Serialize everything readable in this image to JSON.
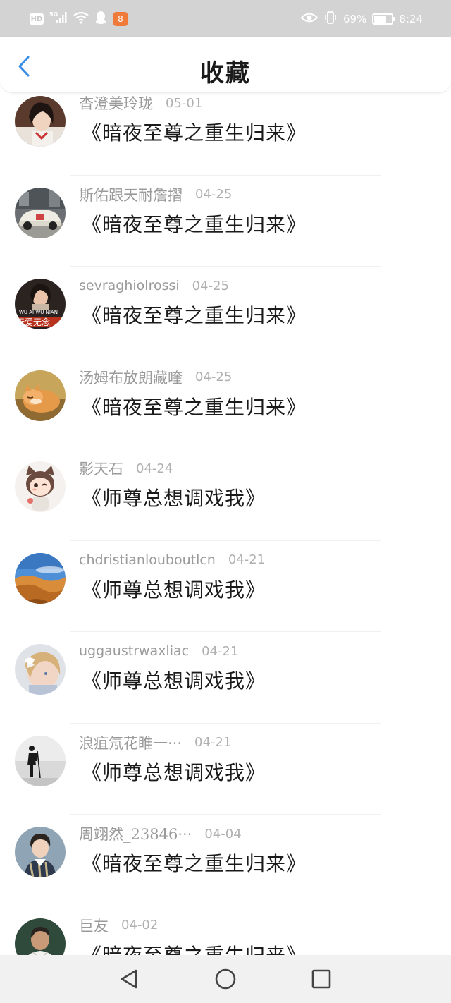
{
  "status_bar": {
    "hd": "HD",
    "network": "5G",
    "app_badge": "8",
    "battery_percent": "69%",
    "battery_level": 0.69,
    "time": "8:24"
  },
  "header": {
    "title": "收藏",
    "back_icon": "chevron-left-icon",
    "accent": "#3a8ee6"
  },
  "favorites": [
    {
      "user": "杳澄美玲珑",
      "date": "05-01",
      "book": "《暗夜至尊之重生归来》",
      "avatar": "woman-portrait"
    },
    {
      "user": "斯佑跟天耐詹摺",
      "date": "04-25",
      "book": "《暗夜至尊之重生归来》",
      "avatar": "vintage-car"
    },
    {
      "user": "sevraghiolrossi",
      "date": "04-25",
      "book": "《暗夜至尊之重生归来》",
      "avatar": "girl-with-text"
    },
    {
      "user": "汤姆布放朗藏喹",
      "date": "04-25",
      "book": "《暗夜至尊之重生归来》",
      "avatar": "sleeping-cat"
    },
    {
      "user": "影天石",
      "date": "04-24",
      "book": "《师尊总想调戏我》",
      "avatar": "cartoon-cat-girl"
    },
    {
      "user": "chdristianlouboutlcn",
      "date": "04-21",
      "book": "《师尊总想调戏我》",
      "avatar": "desert-dunes"
    },
    {
      "user": "uggaustrwaxliac",
      "date": "04-21",
      "book": "《师尊总想调戏我》",
      "avatar": "blonde-girl"
    },
    {
      "user": "浪疽氖花睢一···",
      "date": "04-21",
      "book": "《师尊总想调戏我》",
      "avatar": "hiker-silhouette"
    },
    {
      "user": "周翊然_23846···",
      "date": "04-04",
      "book": "《暗夜至尊之重生归来》",
      "avatar": "young-man"
    },
    {
      "user": "巨友",
      "date": "04-02",
      "book": "《暗夜至尊之重生归来》",
      "avatar": "older-man"
    }
  ],
  "nav_bar": {
    "back": "triangle-back-icon",
    "home": "circle-home-icon",
    "recents": "square-recents-icon"
  }
}
